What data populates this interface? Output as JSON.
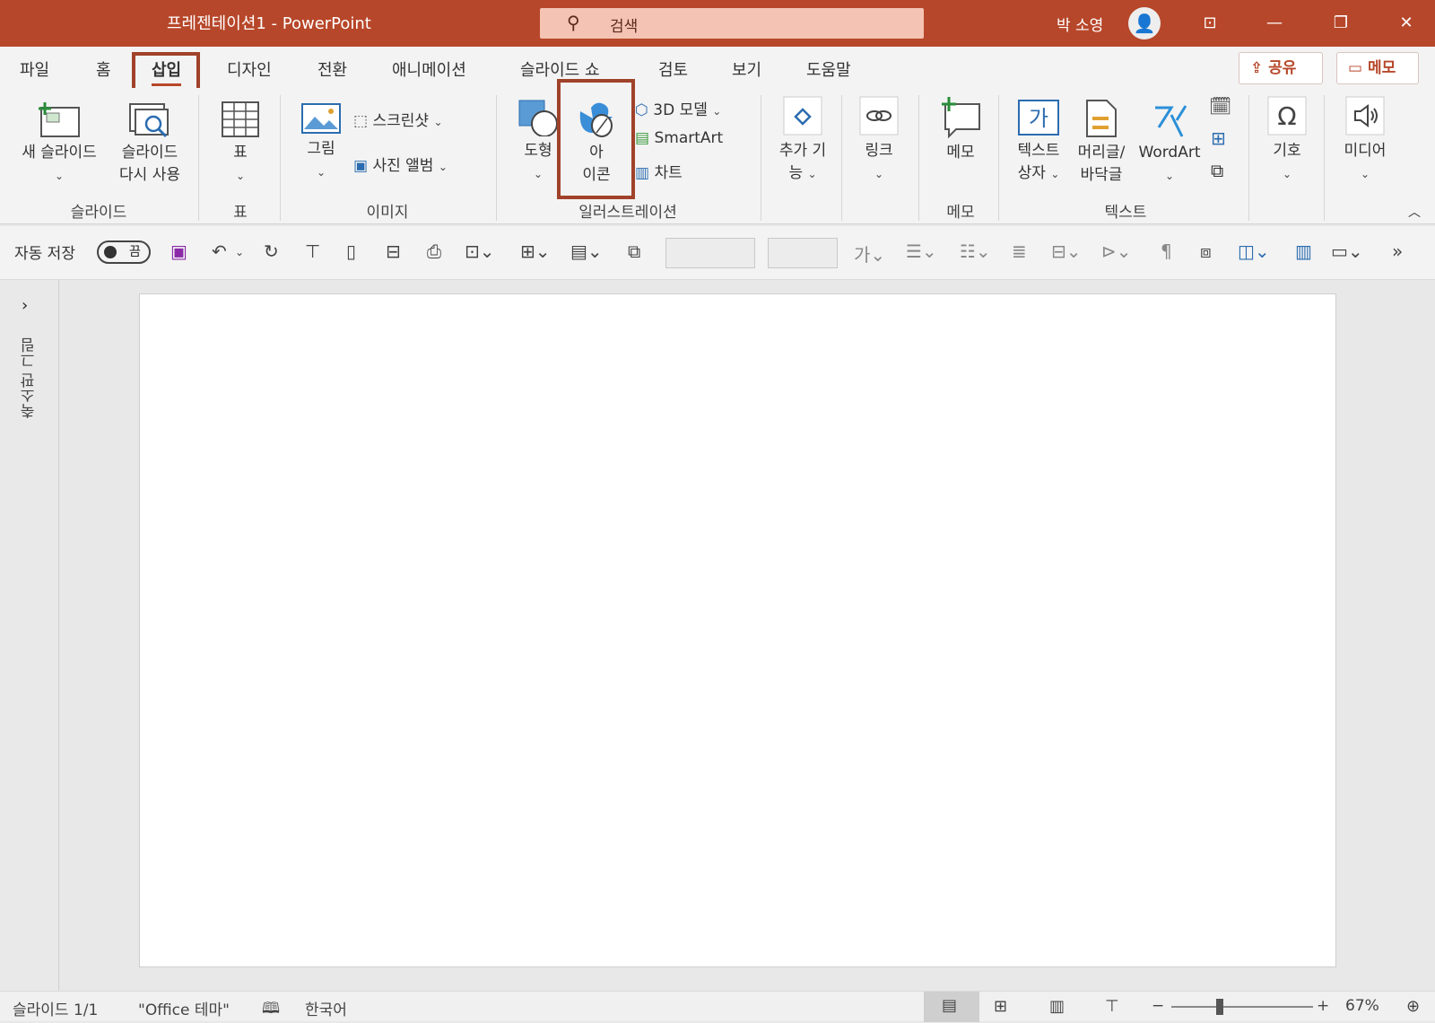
{
  "titlebar": {
    "title": "프레젠테이션1  -  PowerPoint",
    "search_label": "검색",
    "user_name": "박 소영",
    "bg_color": "#b7472a"
  },
  "tabs": [
    {
      "label": "파일"
    },
    {
      "label": "홈"
    },
    {
      "label": "삽입",
      "active": true
    },
    {
      "label": "디자인"
    },
    {
      "label": "전환"
    },
    {
      "label": "애니메이션"
    },
    {
      "label": "슬라이드 쇼"
    },
    {
      "label": "검토"
    },
    {
      "label": "보기"
    },
    {
      "label": "도움말"
    }
  ],
  "share_label": "공유",
  "memo_label": "메모",
  "ribbon": {
    "new_slide": "새 슬라이드",
    "reuse_slide_line1": "슬라이드",
    "reuse_slide_line2": "다시 사용",
    "group_slides": "슬라이드",
    "table": "표",
    "group_table": "표",
    "picture": "그림",
    "screenshot": "스크린샷",
    "photo_album": "사진 앨범",
    "group_images": "이미지",
    "shapes": "도형",
    "icons_line1": "아",
    "icons_line2": "이콘",
    "models_3d": "3D 모델",
    "smartart": "SmartArt",
    "chart": "차트",
    "group_illustrations": "일러스트레이션",
    "addins_line1": "추가 기",
    "addins_line2": "능",
    "link": "링크",
    "comment": "메모",
    "group_comments": "메모",
    "textbox_line1": "텍스트",
    "textbox_line2": "상자",
    "headerfooter_line1": "머리글/",
    "headerfooter_line2": "바닥글",
    "wordart": "WordArt",
    "group_text": "텍스트",
    "symbols": "기호",
    "media": "미디어"
  },
  "qat": {
    "autosave_label": "자동 저장",
    "autosave_state": "끔"
  },
  "left_panel": {
    "label": "축소판 그림"
  },
  "status": {
    "slide_info": "슬라이드 1/1",
    "theme": "\"Office 테마\"",
    "language": "한국어",
    "zoom": "67%"
  }
}
